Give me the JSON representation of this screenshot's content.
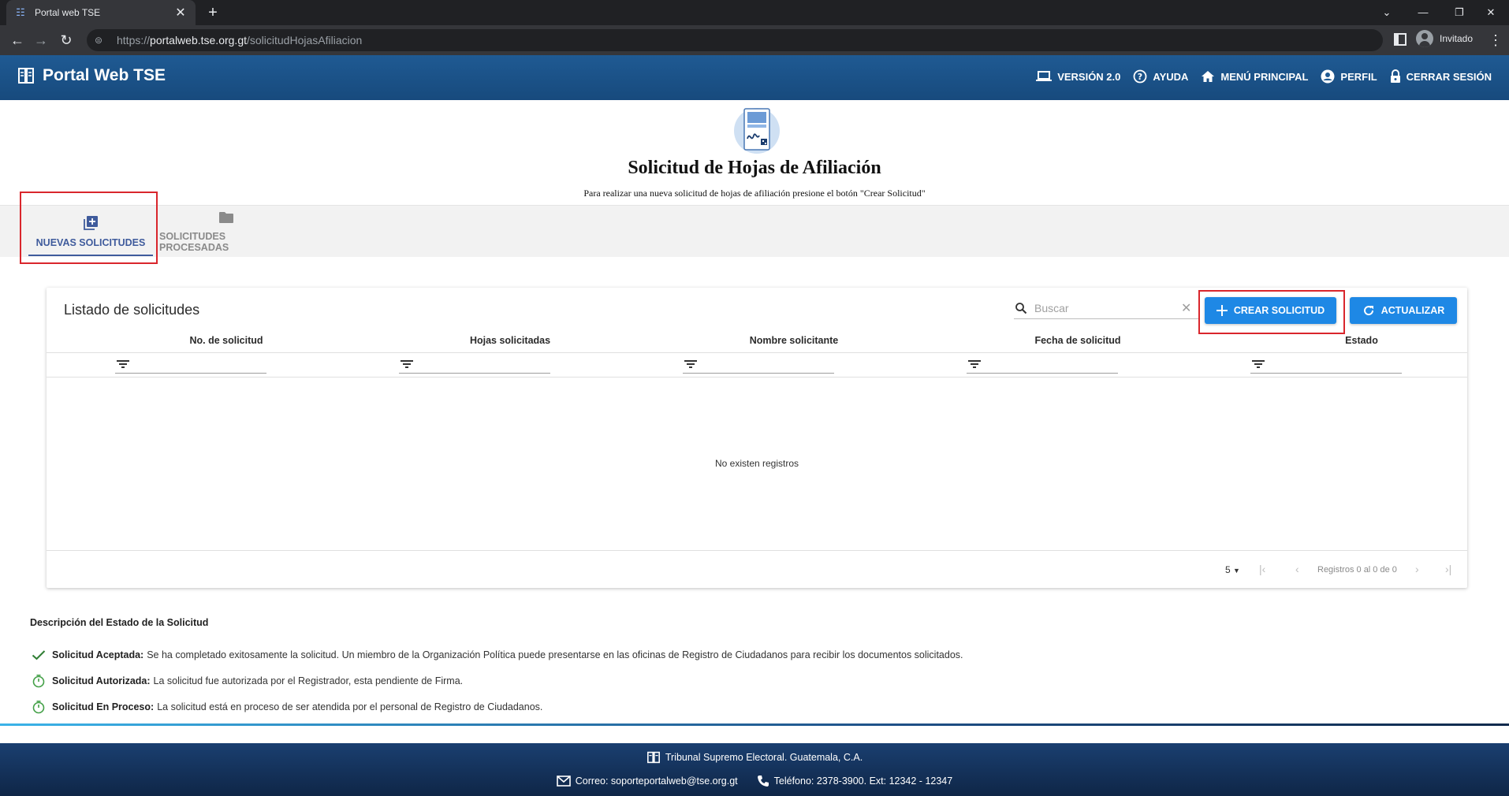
{
  "browser": {
    "tab_title": "Portal web TSE",
    "tab_close": "✕",
    "new_tab": "+",
    "url_scheme": "https://",
    "url_host": "portalweb.tse.org.gt",
    "url_path": "/solicitudHojasAfiliacion",
    "profile_name": "Invitado"
  },
  "header": {
    "brand": "Portal Web TSE",
    "menu": [
      {
        "label": "VERSIÓN 2.0",
        "icon": "laptop-icon"
      },
      {
        "label": "AYUDA",
        "icon": "help-circle-icon"
      },
      {
        "label": "MENÚ PRINCIPAL",
        "icon": "home-icon"
      },
      {
        "label": "PERFIL",
        "icon": "account-circle-icon"
      },
      {
        "label": "CERRAR SESIÓN",
        "icon": "lock-icon"
      }
    ]
  },
  "page": {
    "title": "Solicitud de Hojas de Afiliación",
    "subtitle": "Para realizar una nueva solicitud de hojas de afiliación presione el botón \"Crear Solicitud\""
  },
  "tabs": [
    {
      "label": "NUEVAS SOLICITUDES",
      "active": true,
      "icon": "library-add-icon"
    },
    {
      "label": "SOLICITUDES PROCESADAS",
      "active": false,
      "icon": "folder-icon"
    }
  ],
  "list": {
    "title": "Listado de solicitudes",
    "search_placeholder": "Buscar",
    "create_label": "CREAR SOLICITUD",
    "refresh_label": "ACTUALIZAR",
    "columns": [
      "No. de solicitud",
      "Hojas solicitadas",
      "Nombre solicitante",
      "Fecha de solicitud",
      "Estado"
    ],
    "empty_text": "No existen registros",
    "page_size": "5",
    "page_info": "Registros 0 al 0 de 0"
  },
  "description": {
    "title": "Descripción del Estado de la Solicitud",
    "items": [
      {
        "label": "Solicitud Aceptada:",
        "text": "Se ha completado exitosamente la solicitud. Un miembro de la Organización Política puede presentarse en las oficinas de Registro de Ciudadanos para recibir los documentos solicitados.",
        "icon": "check-icon"
      },
      {
        "label": "Solicitud Autorizada:",
        "text": "La solicitud fue autorizada por el Registrador, esta pendiente de Firma.",
        "icon": "timer-icon"
      },
      {
        "label": "Solicitud En Proceso:",
        "text": "La solicitud está en proceso de ser atendida por el personal de Registro de Ciudadanos.",
        "icon": "timer-icon"
      }
    ]
  },
  "footer": {
    "org": "Tribunal Supremo Electoral. Guatemala, C.A.",
    "email": "Correo: soporteportalweb@tse.org.gt",
    "phone": "Teléfono: 2378-3900. Ext: 12342 - 12347"
  },
  "colors": {
    "header_blue": "#1f5a93",
    "tab_active": "#3f5b9c",
    "button_blue": "#1e88e5",
    "highlight_red": "#d9262c",
    "check_green": "#2e7d32",
    "timer_green": "#43a047"
  }
}
